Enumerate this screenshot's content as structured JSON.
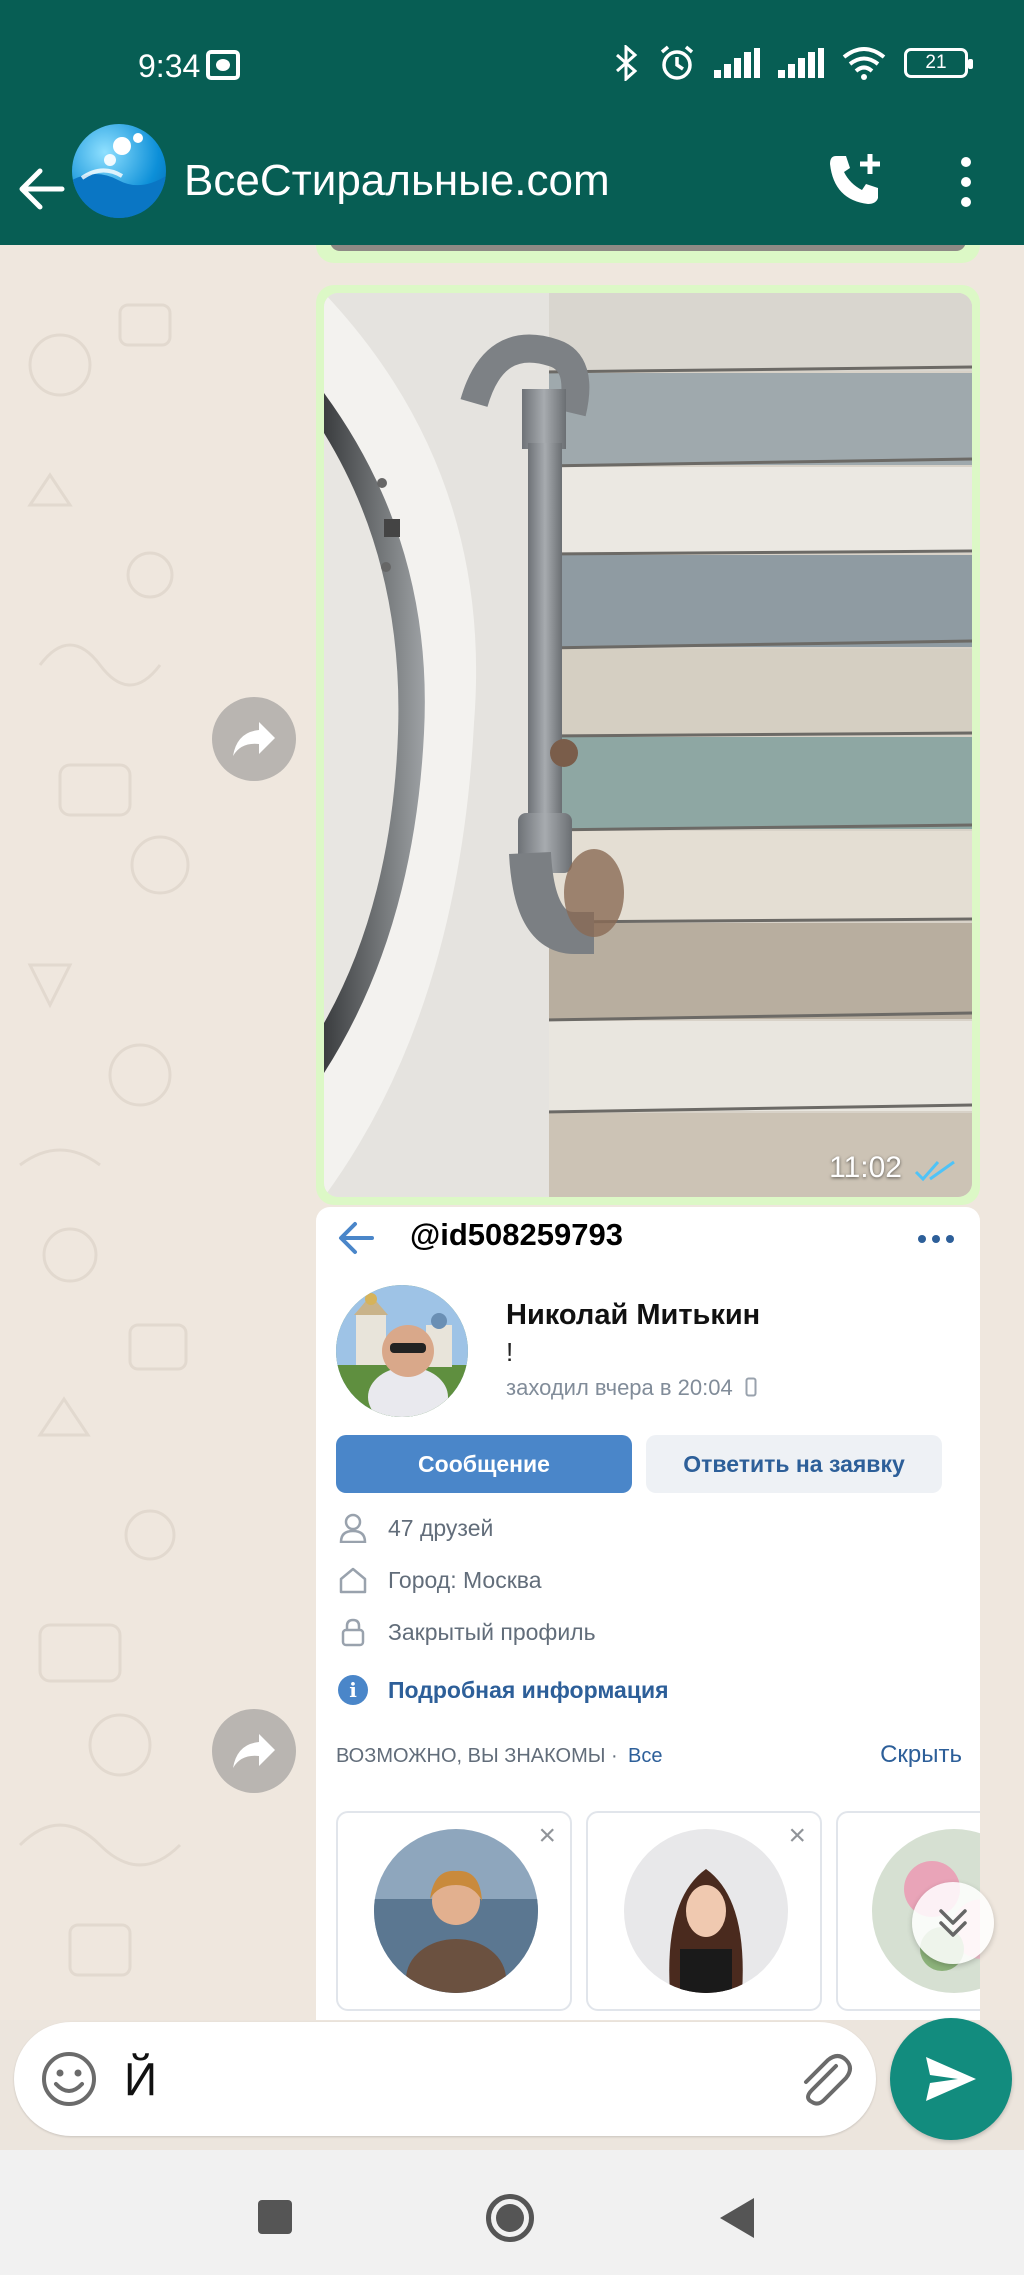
{
  "status_bar": {
    "time": "9:34",
    "battery": "21"
  },
  "app_bar": {
    "title": "ВсеСтиральные.com"
  },
  "messages": [
    {
      "type": "image",
      "subject": "washing machine drain hose against wooden wall",
      "time": "11:02",
      "status": "read"
    },
    {
      "type": "image",
      "subject": "VK profile screenshot",
      "vk": {
        "handle": "@id508259793",
        "name": "Николай Митькин",
        "status": "!",
        "last_seen": "заходил вчера в 20:04",
        "primary_button": "Сообщение",
        "secondary_button": "Ответить на заявку",
        "friends": "47 друзей",
        "city": "Город: Москва",
        "privacy": "Закрытый профиль",
        "more_info": "Подробная информация",
        "suggest_label": "ВОЗМОЖНО, ВЫ ЗНАКОМЫ ·",
        "suggest_all": "Все",
        "hide": "Скрыть"
      }
    }
  ],
  "compose": {
    "value": "Й"
  },
  "colors": {
    "header": "#075e54",
    "outgoing_bubble": "#dcf8c6",
    "send_button": "#128c7e",
    "vk_blue": "#4a86c9"
  }
}
